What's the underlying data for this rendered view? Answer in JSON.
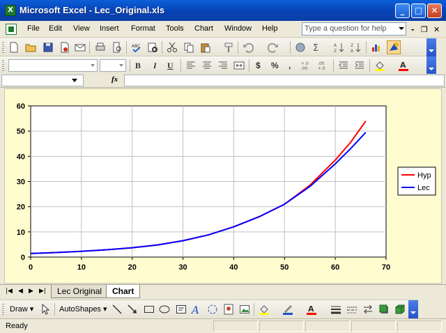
{
  "window": {
    "title": "Microsoft Excel - Lec_Original.xls",
    "minimize_label": "_",
    "maximize_label": "□",
    "close_label": "✕"
  },
  "menu": {
    "items": [
      "File",
      "Edit",
      "View",
      "Insert",
      "Format",
      "Tools",
      "Chart",
      "Window",
      "Help"
    ],
    "help_placeholder": "Type a question for help",
    "doc_minimize": "-",
    "doc_restore": "❐",
    "doc_close": "✕"
  },
  "formula_bar": {
    "fx_label": "fx"
  },
  "toolbar_format": {
    "bold": "B",
    "italic": "I",
    "underline": "U",
    "currency": "$",
    "percent": "%",
    "comma": ",",
    "increase_decimal": "+.0\n.00",
    "decrease_decimal": ".00\n+.0"
  },
  "chart_data": {
    "type": "line",
    "xlim": [
      0,
      70
    ],
    "ylim": [
      0,
      60
    ],
    "x_ticks": [
      0,
      10,
      20,
      30,
      40,
      50,
      60,
      70
    ],
    "y_ticks": [
      0,
      10,
      20,
      30,
      40,
      50,
      60
    ],
    "grid": true,
    "legend_placement": "right",
    "series": [
      {
        "name": "Hyp",
        "color": "#ff0000",
        "x": [
          0,
          5,
          10,
          15,
          20,
          25,
          30,
          35,
          40,
          45,
          50,
          55,
          60,
          63,
          66
        ],
        "y": [
          1.4,
          1.8,
          2.3,
          2.9,
          3.7,
          4.8,
          6.5,
          8.8,
          12,
          16,
          21,
          28.5,
          38.5,
          45.5,
          54
        ]
      },
      {
        "name": "Lec",
        "color": "#0000ff",
        "x": [
          0,
          5,
          10,
          15,
          20,
          25,
          30,
          35,
          40,
          45,
          50,
          55,
          60,
          63,
          66
        ],
        "y": [
          1.4,
          1.8,
          2.3,
          2.9,
          3.7,
          4.8,
          6.5,
          8.8,
          12,
          16,
          21,
          28,
          37,
          43,
          49.5
        ]
      }
    ]
  },
  "sheets": {
    "nav": [
      "|◀",
      "◀",
      "▶",
      "▶|"
    ],
    "tabs": [
      {
        "label": "Lec Original",
        "active": false
      },
      {
        "label": "Chart",
        "active": true
      }
    ]
  },
  "draw_toolbar": {
    "draw_label": "Draw",
    "autoshapes_label": "AutoShapes"
  },
  "status": {
    "text": "Ready"
  }
}
